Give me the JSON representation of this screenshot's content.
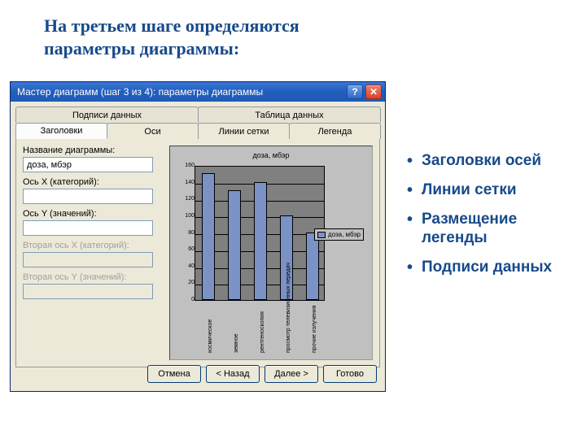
{
  "slide": {
    "title": "На третьем шаге определяются параметры диаграммы:",
    "bullets": [
      "Заголовки осей",
      "Линии сетки",
      "Размещение легенды",
      "Подписи данных"
    ]
  },
  "window": {
    "title": "Мастер диаграмм (шаг 3 из 4): параметры диаграммы",
    "help": "?",
    "close": "✕"
  },
  "tabs": {
    "row1": [
      "Подписи данных",
      "Таблица данных"
    ],
    "row2": [
      "Заголовки",
      "Оси",
      "Линии сетки",
      "Легенда"
    ]
  },
  "form": {
    "chart_title_label": "Название диаграммы:",
    "chart_title_value": "доза, мбэр",
    "x_label": "Ось X (категорий):",
    "x_value": "",
    "y_label": "Ось Y (значений):",
    "y_value": "",
    "x2_label": "Вторая ось X (категорий):",
    "x2_value": "",
    "y2_label": "Вторая ось Y (значений):",
    "y2_value": ""
  },
  "buttons": {
    "cancel": "Отмена",
    "back": "< Назад",
    "next": "Далее >",
    "finish": "Готово"
  },
  "chart_data": {
    "type": "bar",
    "title": "доза, мбэр",
    "categories": [
      "космическое",
      "земное",
      "рентгеноскопия",
      "просмотр телевизионных передач",
      "прочие излучения"
    ],
    "values": [
      150,
      130,
      140,
      100,
      80
    ],
    "ylim": [
      0,
      160
    ],
    "yticks": [
      0,
      20,
      40,
      60,
      80,
      100,
      120,
      140,
      160
    ],
    "legend": "доза, мбэр",
    "xlabel": "",
    "ylabel": ""
  }
}
